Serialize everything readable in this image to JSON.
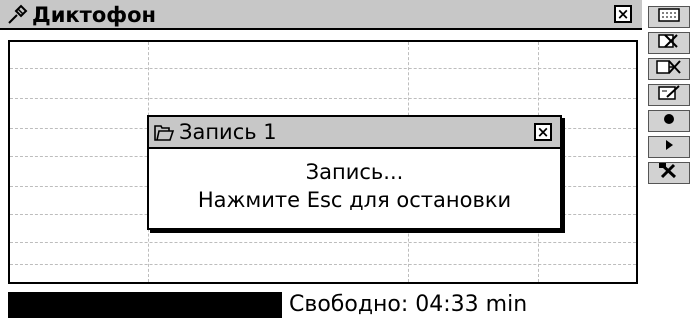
{
  "window": {
    "title": "Диктофон",
    "title_icon": "microphone-icon",
    "close_icon": "close-icon"
  },
  "dialog": {
    "title": "Запись 1",
    "title_icon": "folder-icon",
    "close_icon": "close-icon",
    "line1": "Запись...",
    "line2": "Нажмите Esc для остановки"
  },
  "status": {
    "free_text": "Свободно: 04:33 min"
  },
  "toolbar": {
    "items": [
      {
        "icon": "list-view-icon"
      },
      {
        "icon": "delete-icon"
      },
      {
        "icon": "delete-all-icon"
      },
      {
        "icon": "rename-icon"
      },
      {
        "icon": "record-icon"
      },
      {
        "icon": "play-icon"
      },
      {
        "icon": "tools-icon"
      }
    ]
  }
}
